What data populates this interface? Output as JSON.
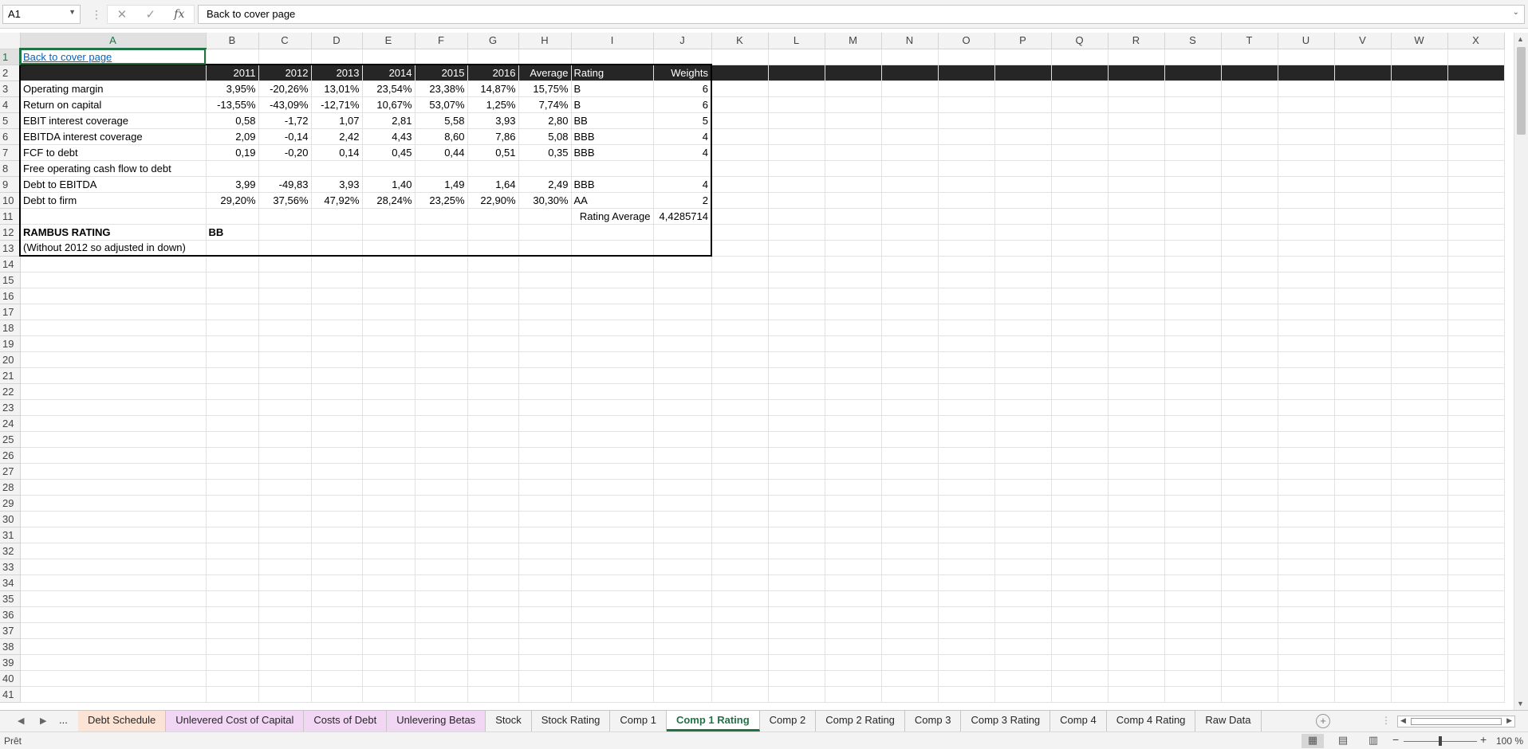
{
  "formula_bar": {
    "name_box": "A1",
    "formula": "Back to cover page"
  },
  "columns": [
    "A",
    "B",
    "C",
    "D",
    "E",
    "F",
    "G",
    "H",
    "I",
    "J",
    "K",
    "L",
    "M",
    "N",
    "O",
    "P",
    "Q",
    "R",
    "S",
    "T",
    "U",
    "V",
    "W",
    "X"
  ],
  "rows": {
    "r1": {
      "A": "Back to cover page"
    },
    "r2": {
      "B": "2011",
      "C": "2012",
      "D": "2013",
      "E": "2014",
      "F": "2015",
      "G": "2016",
      "H": "Average",
      "I": "Rating",
      "J": "Weights"
    },
    "r3": {
      "A": "Operating margin",
      "B": "3,95%",
      "C": "-20,26%",
      "D": "13,01%",
      "E": "23,54%",
      "F": "23,38%",
      "G": "14,87%",
      "H": "15,75%",
      "I": "B",
      "J": "6"
    },
    "r4": {
      "A": "Return on capital",
      "B": "-13,55%",
      "C": "-43,09%",
      "D": "-12,71%",
      "E": "10,67%",
      "F": "53,07%",
      "G": "1,25%",
      "H": "7,74%",
      "I": "B",
      "J": "6"
    },
    "r5": {
      "A": "EBIT interest coverage",
      "B": "0,58",
      "C": "-1,72",
      "D": "1,07",
      "E": "2,81",
      "F": "5,58",
      "G": "3,93",
      "H": "2,80",
      "I": "BB",
      "J": "5"
    },
    "r6": {
      "A": "EBITDA interest coverage",
      "B": "2,09",
      "C": "-0,14",
      "D": "2,42",
      "E": "4,43",
      "F": "8,60",
      "G": "7,86",
      "H": "5,08",
      "I": "BBB",
      "J": "4"
    },
    "r7": {
      "A": "FCF to debt",
      "B": "0,19",
      "C": "-0,20",
      "D": "0,14",
      "E": "0,45",
      "F": "0,44",
      "G": "0,51",
      "H": "0,35",
      "I": "BBB",
      "J": "4"
    },
    "r8": {
      "A": "Free operating cash flow to debt"
    },
    "r9": {
      "A": "Debt to EBITDA",
      "B": "3,99",
      "C": "-49,83",
      "D": "3,93",
      "E": "1,40",
      "F": "1,49",
      "G": "1,64",
      "H": "2,49",
      "I": "BBB",
      "J": "4"
    },
    "r10": {
      "A": "Debt to firm",
      "B": "29,20%",
      "C": "37,56%",
      "D": "47,92%",
      "E": "28,24%",
      "F": "23,25%",
      "G": "22,90%",
      "H": "30,30%",
      "I": "AA",
      "J": "2"
    },
    "r11": {
      "I": "Rating Average",
      "J": "4,4285714"
    },
    "r12": {
      "A": "RAMBUS RATING",
      "B": "BB"
    },
    "r13": {
      "A": "(Without 2012 so adjusted in down)"
    }
  },
  "sheet_tabs": [
    {
      "label": "Debt Schedule",
      "color": "#fbe4d5"
    },
    {
      "label": "Unlevered Cost of Capital",
      "color": "#f2d7f5"
    },
    {
      "label": "Costs of Debt",
      "color": "#f2d7f5"
    },
    {
      "label": "Unlevering Betas",
      "color": "#f2d7f5"
    },
    {
      "label": "Stock",
      "color": ""
    },
    {
      "label": "Stock Rating",
      "color": ""
    },
    {
      "label": "Comp 1",
      "color": ""
    },
    {
      "label": "Comp 1 Rating",
      "color": "",
      "active": true
    },
    {
      "label": "Comp 2",
      "color": ""
    },
    {
      "label": "Comp 2 Rating",
      "color": ""
    },
    {
      "label": "Comp 3",
      "color": ""
    },
    {
      "label": "Comp 3 Rating",
      "color": ""
    },
    {
      "label": "Comp 4",
      "color": ""
    },
    {
      "label": "Comp 4 Rating",
      "color": ""
    },
    {
      "label": "Raw Data",
      "color": ""
    }
  ],
  "tabnav": {
    "ellipsis": "..."
  },
  "status": {
    "text": "Prêt",
    "zoom": "100 %"
  }
}
